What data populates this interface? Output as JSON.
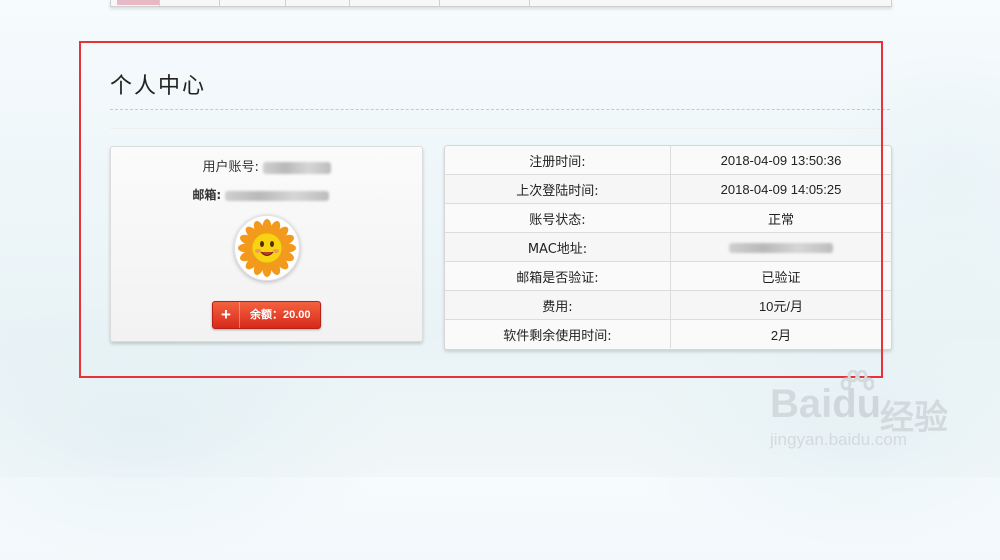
{
  "page": {
    "title": "个人中心"
  },
  "account_card": {
    "account_label": "用户账号:",
    "email_label": "邮箱:",
    "balance_button": {
      "icon": "+",
      "label": "余额：20.00"
    }
  },
  "info_table": {
    "rows": [
      {
        "key": "注册时间:",
        "value": "2018-04-09 13:50:36"
      },
      {
        "key": "上次登陆时间:",
        "value": "2018-04-09 14:05:25"
      },
      {
        "key": "账号状态:",
        "value": "正常"
      },
      {
        "key": "MAC地址:",
        "value": ""
      },
      {
        "key": "邮箱是否验证:",
        "value": "已验证"
      },
      {
        "key": "费用:",
        "value": "10元/月"
      },
      {
        "key": "软件剩余使用时间:",
        "value": "2月"
      }
    ]
  },
  "watermark": {
    "brand": "Bai",
    "brand_suffix": "du",
    "cn": "经验",
    "url": "jingyan.baidu.com"
  },
  "colors": {
    "highlight_frame": "#e8323a",
    "button": "#e03a26"
  },
  "icons": [
    "sun-avatar-icon",
    "plus-icon",
    "paw-icon"
  ]
}
